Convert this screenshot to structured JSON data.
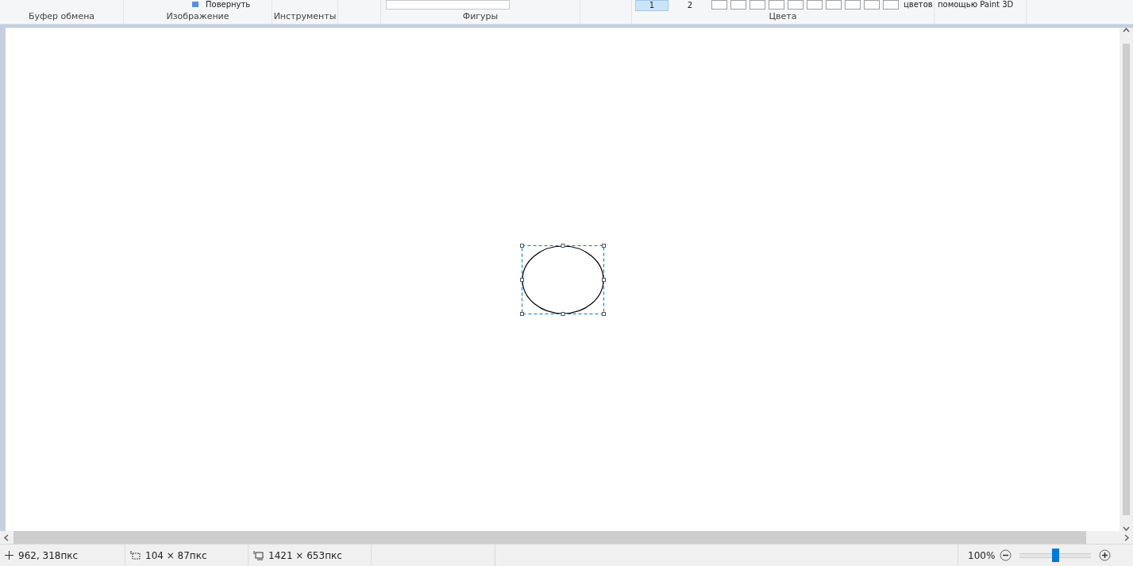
{
  "ribbon": {
    "rotate_label": "Повернуть",
    "color_slots": [
      {
        "label": "1",
        "selected": true
      },
      {
        "label": "2",
        "selected": false
      }
    ],
    "edit_colors_label": "цветов",
    "paint3d_label": "помощью Paint 3D",
    "groups": [
      {
        "label": "Буфер обмена"
      },
      {
        "label": "Изображение"
      },
      {
        "label": "Инструменты"
      },
      {
        "label": "Фигуры"
      },
      {
        "label": "Цвета"
      }
    ]
  },
  "status_bar": {
    "cursor_position": "962, 318пкс",
    "selection_size": "104 × 87пкс",
    "canvas_size": "1421 × 653пкс",
    "zoom": "100%",
    "zoom_slider": {
      "level": 0.5
    }
  }
}
